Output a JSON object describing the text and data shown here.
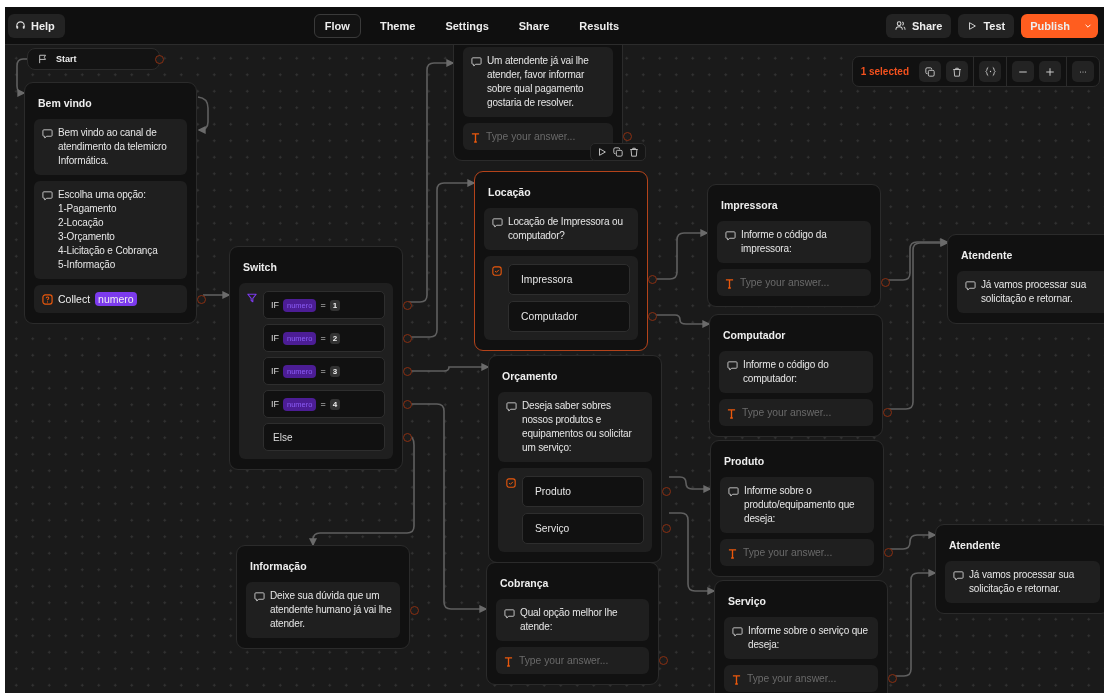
{
  "topbar": {
    "help": "Help",
    "tabs": [
      {
        "label": "Flow",
        "selected": true
      },
      {
        "label": "Theme",
        "selected": false
      },
      {
        "label": "Settings",
        "selected": false
      },
      {
        "label": "Share",
        "selected": false
      },
      {
        "label": "Results",
        "selected": false
      }
    ],
    "share": "Share",
    "test": "Test",
    "publish": "Publish"
  },
  "selection_toolbar": {
    "status": "1 selected"
  },
  "nodes": [
    {
      "kind": "start",
      "title": "Start"
    },
    {
      "kind": "group",
      "title": "Bem vindo",
      "selected": false,
      "output": true,
      "blocks": [
        {
          "kind": "text",
          "text": "Bem vindo ao canal de atendimento da telemicro Informática."
        },
        {
          "kind": "text",
          "text": "Escolha uma opção:\n1-Pagamento\n2-Locação\n3-Orçamento\n4-Licitação e Cobrança\n5-Informação"
        },
        {
          "kind": "collect",
          "label": "Collect",
          "variable": "numero"
        }
      ]
    },
    {
      "kind": "group",
      "title": "Switch",
      "selected": false,
      "blocks": [
        {
          "kind": "conditions",
          "items": [
            {
              "kind": "if",
              "keyword": "IF",
              "variable": "numero",
              "operator": "=",
              "value": "1"
            },
            {
              "kind": "if",
              "keyword": "IF",
              "variable": "numero",
              "operator": "=",
              "value": "2"
            },
            {
              "kind": "if",
              "keyword": "IF",
              "variable": "numero",
              "operator": "=",
              "value": "3"
            },
            {
              "kind": "if",
              "keyword": "IF",
              "variable": "numero",
              "operator": "=",
              "value": "4"
            },
            {
              "kind": "else",
              "label": "Else"
            }
          ]
        }
      ]
    },
    {
      "kind": "group",
      "title": "Informação",
      "selected": false,
      "output": true,
      "blocks": [
        {
          "kind": "text",
          "text": "Deixe sua dúvida que um atendente humano já vai lhe atender."
        }
      ]
    },
    {
      "kind": "group",
      "selected": false,
      "output": true,
      "actions": true,
      "blocks": [
        {
          "kind": "text",
          "text": "Um atendente já vai lhe atender, favor informar sobre qual pagamento gostaria de resolver."
        },
        {
          "kind": "input",
          "placeholder": "Type your answer..."
        }
      ]
    },
    {
      "kind": "group",
      "title": "Locação",
      "selected": true,
      "blocks": [
        {
          "kind": "text",
          "text": "Locação de Impressora ou computador?"
        },
        {
          "kind": "choice",
          "items": [
            "Impressora",
            "Computador"
          ]
        }
      ]
    },
    {
      "kind": "group",
      "title": "Orçamento",
      "selected": false,
      "blocks": [
        {
          "kind": "text",
          "text": "Deseja saber sobres nossos produtos e equipamentos ou solicitar um serviço:"
        },
        {
          "kind": "choice",
          "items": [
            "Produto",
            "Serviço"
          ]
        }
      ]
    },
    {
      "kind": "group",
      "title": "Cobrança",
      "selected": false,
      "output": true,
      "blocks": [
        {
          "kind": "text",
          "text": "Qual opção melhor lhe atende:"
        },
        {
          "kind": "input",
          "placeholder": "Type your answer..."
        }
      ]
    },
    {
      "kind": "group",
      "title": "Impressora",
      "selected": false,
      "output": true,
      "blocks": [
        {
          "kind": "text",
          "text": "Informe o código da impressora:"
        },
        {
          "kind": "input",
          "placeholder": "Type your answer..."
        }
      ]
    },
    {
      "kind": "group",
      "title": "Computador",
      "selected": false,
      "output": true,
      "blocks": [
        {
          "kind": "text",
          "text": "Informe o código do computador:"
        },
        {
          "kind": "input",
          "placeholder": "Type your answer..."
        }
      ]
    },
    {
      "kind": "group",
      "title": "Produto",
      "selected": false,
      "output": true,
      "blocks": [
        {
          "kind": "text",
          "text": "Informe sobre o produto/equipamento que deseja:"
        },
        {
          "kind": "input",
          "placeholder": "Type your answer..."
        }
      ]
    },
    {
      "kind": "group",
      "title": "Serviço",
      "selected": false,
      "output": true,
      "blocks": [
        {
          "kind": "text",
          "text": "Informe sobre o serviço que deseja:"
        },
        {
          "kind": "input",
          "placeholder": "Type your answer..."
        }
      ]
    },
    {
      "kind": "group",
      "title": "Atendente",
      "selected": false,
      "blocks": [
        {
          "kind": "text",
          "text": "Já vamos processar sua solicitação e retornar."
        }
      ]
    },
    {
      "kind": "group",
      "title": "Atendente",
      "selected": false,
      "blocks": [
        {
          "kind": "text",
          "text": "Já vamos processar sua solicitação e retornar."
        }
      ]
    }
  ]
}
